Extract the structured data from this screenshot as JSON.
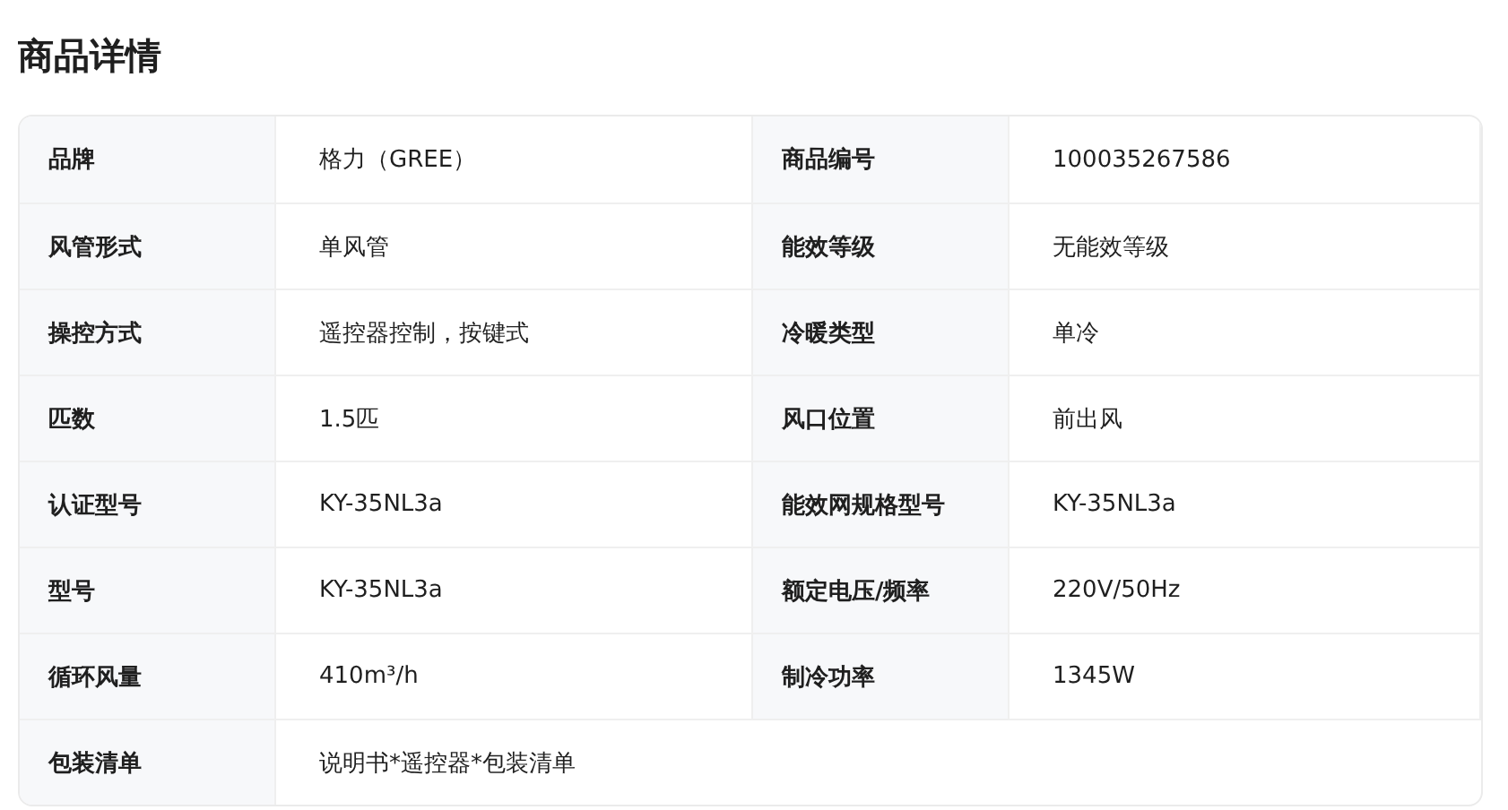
{
  "title": "商品详情",
  "specs": [
    {
      "label": "品牌",
      "value": "格力（GREE）"
    },
    {
      "label": "商品编号",
      "value": "100035267586"
    },
    {
      "label": "风管形式",
      "value": "单风管"
    },
    {
      "label": "能效等级",
      "value": "无能效等级"
    },
    {
      "label": "操控方式",
      "value": "遥控器控制，按键式"
    },
    {
      "label": "冷暖类型",
      "value": "单冷"
    },
    {
      "label": "匹数",
      "value": "1.5匹"
    },
    {
      "label": "风口位置",
      "value": "前出风"
    },
    {
      "label": "认证型号",
      "value": "KY-35NL3a"
    },
    {
      "label": "能效网规格型号",
      "value": "KY-35NL3a"
    },
    {
      "label": "型号",
      "value": "KY-35NL3a"
    },
    {
      "label": "额定电压/频率",
      "value": "220V/50Hz"
    },
    {
      "label": "循环风量",
      "value": "410m³/h"
    },
    {
      "label": "制冷功率",
      "value": "1345W"
    },
    {
      "label": "包装清单",
      "value": "说明书*遥控器*包装清单"
    }
  ]
}
